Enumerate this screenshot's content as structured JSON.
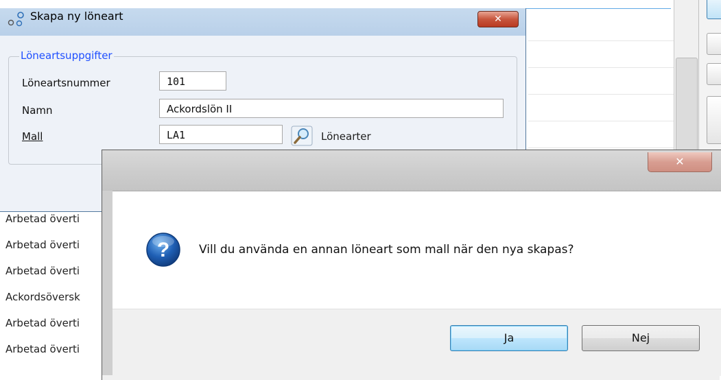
{
  "parent_dialog": {
    "title": "Skapa ny löneart",
    "close_glyph": "✕",
    "group_title": "Löneartsuppgifter",
    "fields": {
      "number_label": "Löneartsnummer",
      "number_value": "101",
      "name_label": "Namn",
      "name_value": "Ackordslön II",
      "template_label": "Mall",
      "template_value": "LA1",
      "lookup_label": "Lönearter"
    }
  },
  "background_list": {
    "rows": [
      "Arbetad överti",
      "Arbetad överti",
      "Arbetad överti",
      "Ackordsöversk",
      "Arbetad överti",
      "Arbetad överti"
    ]
  },
  "message_box": {
    "close_glyph": "✕",
    "icon": "question-icon",
    "text": "Vill du använda en annan löneart som mall när den nya skapas?",
    "yes_label": "Ja",
    "no_label": "Nej"
  },
  "colors": {
    "group_title": "#1f4fff",
    "close_red": "#c7553d",
    "default_button": "#3c7fb1"
  }
}
